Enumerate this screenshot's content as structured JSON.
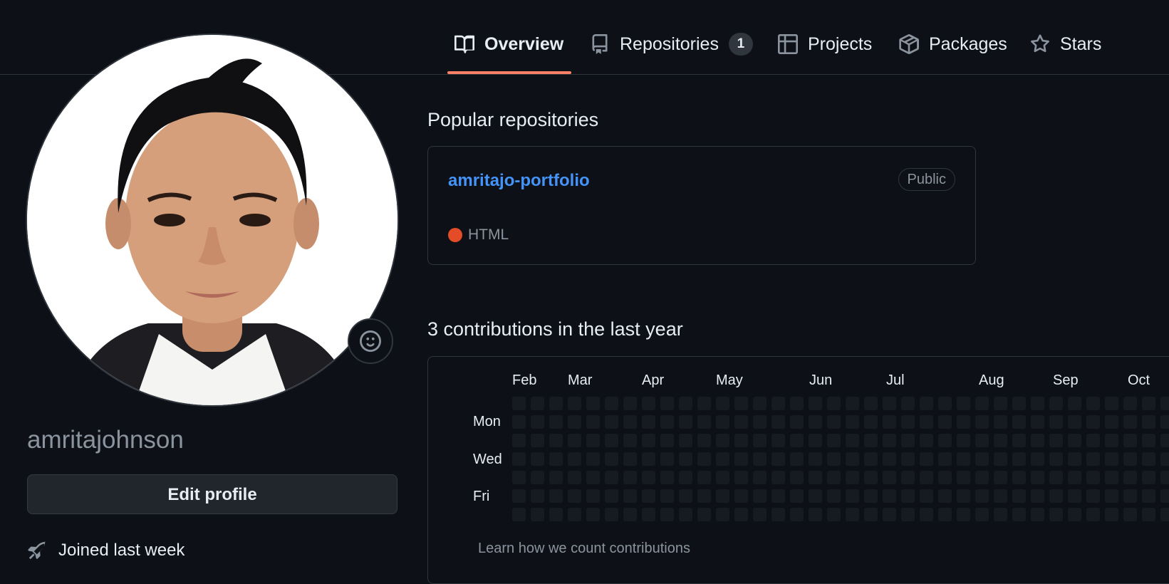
{
  "nav": {
    "tabs": [
      {
        "label": "Overview",
        "icon": "book-icon",
        "selected": true
      },
      {
        "label": "Repositories",
        "icon": "repo-icon",
        "count": "1"
      },
      {
        "label": "Projects",
        "icon": "table-icon"
      },
      {
        "label": "Packages",
        "icon": "package-icon"
      },
      {
        "label": "Stars",
        "icon": "star-icon"
      }
    ]
  },
  "profile": {
    "username": "amritajohnson",
    "edit_label": "Edit profile",
    "joined": "Joined last week"
  },
  "popular": {
    "title": "Popular repositories",
    "repo": {
      "name": "amritajo-portfolio",
      "visibility": "Public",
      "language": "HTML",
      "language_color": "#e34c26"
    }
  },
  "contributions": {
    "title": "3 contributions in the last year",
    "months": [
      "Feb",
      "Mar",
      "Apr",
      "May",
      "Jun",
      "Jul",
      "Aug",
      "Sep",
      "Oct"
    ],
    "days": [
      "Mon",
      "Wed",
      "Fri"
    ],
    "learn_link": "Learn how we count contributions",
    "empty_color": "#161b22"
  },
  "colors": {
    "background": "#0d1117",
    "border": "#30363d",
    "accent_underline": "#f78166",
    "link": "#4493f8"
  }
}
